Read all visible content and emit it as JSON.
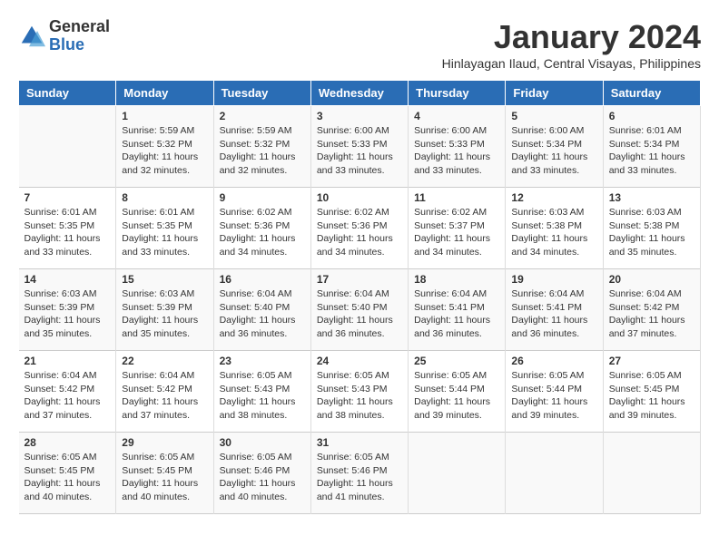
{
  "logo": {
    "general": "General",
    "blue": "Blue"
  },
  "title": "January 2024",
  "location": "Hinlayagan Ilaud, Central Visayas, Philippines",
  "days_header": [
    "Sunday",
    "Monday",
    "Tuesday",
    "Wednesday",
    "Thursday",
    "Friday",
    "Saturday"
  ],
  "weeks": [
    [
      {
        "day": "",
        "info": ""
      },
      {
        "day": "1",
        "info": "Sunrise: 5:59 AM\nSunset: 5:32 PM\nDaylight: 11 hours\nand 32 minutes."
      },
      {
        "day": "2",
        "info": "Sunrise: 5:59 AM\nSunset: 5:32 PM\nDaylight: 11 hours\nand 32 minutes."
      },
      {
        "day": "3",
        "info": "Sunrise: 6:00 AM\nSunset: 5:33 PM\nDaylight: 11 hours\nand 33 minutes."
      },
      {
        "day": "4",
        "info": "Sunrise: 6:00 AM\nSunset: 5:33 PM\nDaylight: 11 hours\nand 33 minutes."
      },
      {
        "day": "5",
        "info": "Sunrise: 6:00 AM\nSunset: 5:34 PM\nDaylight: 11 hours\nand 33 minutes."
      },
      {
        "day": "6",
        "info": "Sunrise: 6:01 AM\nSunset: 5:34 PM\nDaylight: 11 hours\nand 33 minutes."
      }
    ],
    [
      {
        "day": "7",
        "info": "Sunrise: 6:01 AM\nSunset: 5:35 PM\nDaylight: 11 hours\nand 33 minutes."
      },
      {
        "day": "8",
        "info": "Sunrise: 6:01 AM\nSunset: 5:35 PM\nDaylight: 11 hours\nand 33 minutes."
      },
      {
        "day": "9",
        "info": "Sunrise: 6:02 AM\nSunset: 5:36 PM\nDaylight: 11 hours\nand 34 minutes."
      },
      {
        "day": "10",
        "info": "Sunrise: 6:02 AM\nSunset: 5:36 PM\nDaylight: 11 hours\nand 34 minutes."
      },
      {
        "day": "11",
        "info": "Sunrise: 6:02 AM\nSunset: 5:37 PM\nDaylight: 11 hours\nand 34 minutes."
      },
      {
        "day": "12",
        "info": "Sunrise: 6:03 AM\nSunset: 5:38 PM\nDaylight: 11 hours\nand 34 minutes."
      },
      {
        "day": "13",
        "info": "Sunrise: 6:03 AM\nSunset: 5:38 PM\nDaylight: 11 hours\nand 35 minutes."
      }
    ],
    [
      {
        "day": "14",
        "info": "Sunrise: 6:03 AM\nSunset: 5:39 PM\nDaylight: 11 hours\nand 35 minutes."
      },
      {
        "day": "15",
        "info": "Sunrise: 6:03 AM\nSunset: 5:39 PM\nDaylight: 11 hours\nand 35 minutes."
      },
      {
        "day": "16",
        "info": "Sunrise: 6:04 AM\nSunset: 5:40 PM\nDaylight: 11 hours\nand 36 minutes."
      },
      {
        "day": "17",
        "info": "Sunrise: 6:04 AM\nSunset: 5:40 PM\nDaylight: 11 hours\nand 36 minutes."
      },
      {
        "day": "18",
        "info": "Sunrise: 6:04 AM\nSunset: 5:41 PM\nDaylight: 11 hours\nand 36 minutes."
      },
      {
        "day": "19",
        "info": "Sunrise: 6:04 AM\nSunset: 5:41 PM\nDaylight: 11 hours\nand 36 minutes."
      },
      {
        "day": "20",
        "info": "Sunrise: 6:04 AM\nSunset: 5:42 PM\nDaylight: 11 hours\nand 37 minutes."
      }
    ],
    [
      {
        "day": "21",
        "info": "Sunrise: 6:04 AM\nSunset: 5:42 PM\nDaylight: 11 hours\nand 37 minutes."
      },
      {
        "day": "22",
        "info": "Sunrise: 6:04 AM\nSunset: 5:42 PM\nDaylight: 11 hours\nand 37 minutes."
      },
      {
        "day": "23",
        "info": "Sunrise: 6:05 AM\nSunset: 5:43 PM\nDaylight: 11 hours\nand 38 minutes."
      },
      {
        "day": "24",
        "info": "Sunrise: 6:05 AM\nSunset: 5:43 PM\nDaylight: 11 hours\nand 38 minutes."
      },
      {
        "day": "25",
        "info": "Sunrise: 6:05 AM\nSunset: 5:44 PM\nDaylight: 11 hours\nand 39 minutes."
      },
      {
        "day": "26",
        "info": "Sunrise: 6:05 AM\nSunset: 5:44 PM\nDaylight: 11 hours\nand 39 minutes."
      },
      {
        "day": "27",
        "info": "Sunrise: 6:05 AM\nSunset: 5:45 PM\nDaylight: 11 hours\nand 39 minutes."
      }
    ],
    [
      {
        "day": "28",
        "info": "Sunrise: 6:05 AM\nSunset: 5:45 PM\nDaylight: 11 hours\nand 40 minutes."
      },
      {
        "day": "29",
        "info": "Sunrise: 6:05 AM\nSunset: 5:45 PM\nDaylight: 11 hours\nand 40 minutes."
      },
      {
        "day": "30",
        "info": "Sunrise: 6:05 AM\nSunset: 5:46 PM\nDaylight: 11 hours\nand 40 minutes."
      },
      {
        "day": "31",
        "info": "Sunrise: 6:05 AM\nSunset: 5:46 PM\nDaylight: 11 hours\nand 41 minutes."
      },
      {
        "day": "",
        "info": ""
      },
      {
        "day": "",
        "info": ""
      },
      {
        "day": "",
        "info": ""
      }
    ]
  ]
}
